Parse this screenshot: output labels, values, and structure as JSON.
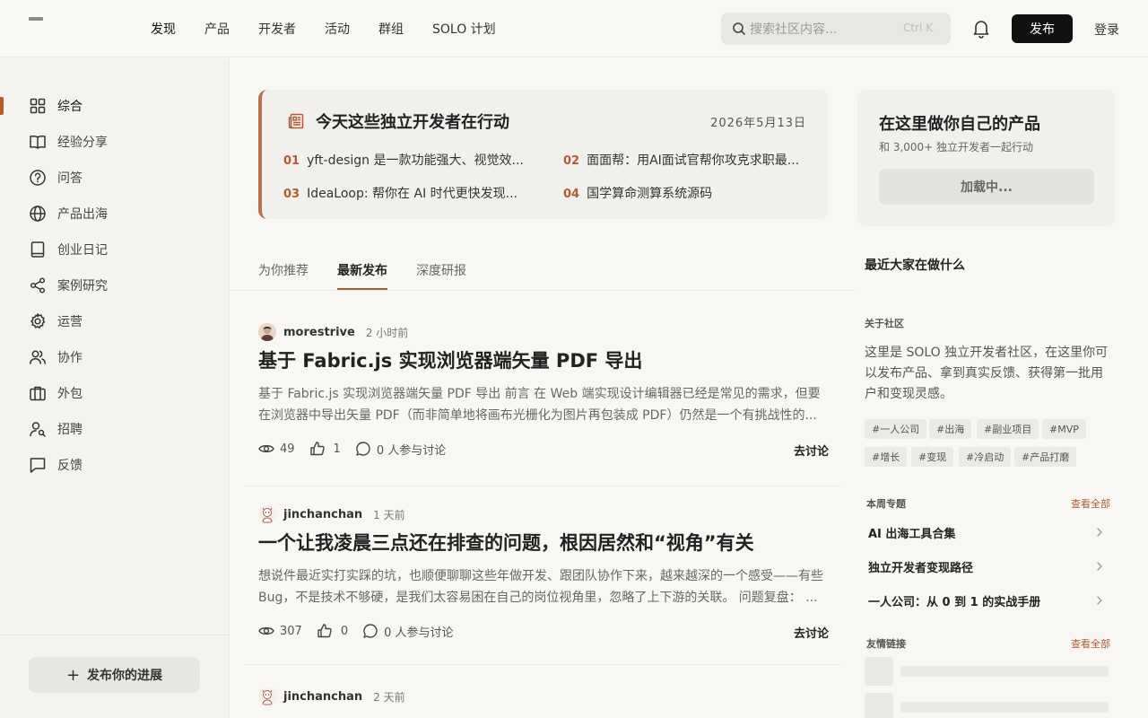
{
  "nav": {
    "items": [
      "发现",
      "产品",
      "开发者",
      "活动",
      "群组",
      "SOLO 计划"
    ],
    "search_placeholder": "搜索社区内容...",
    "search_shortcut": "Ctrl K",
    "publish_label": "发布",
    "login_label": "登录"
  },
  "sidebar": {
    "items": [
      {
        "label": "综合",
        "icon": "grid-icon"
      },
      {
        "label": "经验分享",
        "icon": "book-open-icon"
      },
      {
        "label": "问答",
        "icon": "question-circle-icon"
      },
      {
        "label": "产品出海",
        "icon": "globe-icon"
      },
      {
        "label": "创业日记",
        "icon": "notebook-icon"
      },
      {
        "label": "案例研究",
        "icon": "share-icon"
      },
      {
        "label": "运营",
        "icon": "gear-icon"
      },
      {
        "label": "协作",
        "icon": "users-icon"
      },
      {
        "label": "外包",
        "icon": "briefcase-icon"
      },
      {
        "label": "招聘",
        "icon": "user-search-icon"
      },
      {
        "label": "反馈",
        "icon": "message-square-icon"
      }
    ],
    "progress_button": "发布你的进展",
    "progress_plus": "+"
  },
  "today": {
    "title": "今天这些独立开发者在行动",
    "date": "2026年5月13日",
    "items": [
      {
        "num": "01",
        "text": "yft-design 是一款功能强大、视觉效..."
      },
      {
        "num": "02",
        "text": "面面帮：用AI面试官帮你攻克求职最..."
      },
      {
        "num": "03",
        "text": "IdeaLoop: 帮你在 AI 时代更快发现..."
      },
      {
        "num": "04",
        "text": "国学算命测算系统源码"
      }
    ]
  },
  "tabs": [
    "为你推荐",
    "最新发布",
    "深度研报"
  ],
  "posts": [
    {
      "author": "morestrive",
      "time": "2 小时前",
      "title": "基于 Fabric.js 实现浏览器端矢量 PDF 导出",
      "excerpt": "基于 Fabric.js 实现浏览器端矢量 PDF 导出 前言 在 Web 端实现设计编辑器已经是常见的需求，但要在浏览器中导出矢量 PDF（而非简单地将画布光栅化为图片再包装成 PDF）仍然是一个有挑战性的...",
      "views": "49",
      "likes": "1",
      "comments": "0 人参与讨论",
      "discuss": "去讨论"
    },
    {
      "author": "jinchanchan",
      "time": "1 天前",
      "title": "一个让我凌晨三点还在排查的问题，根因居然和“视角”有关",
      "excerpt": "想说件最近实打实踩的坑，也顺便聊聊这些年做开发、跟团队协作下来，越来越深的一个感受——有些 Bug，不是技术不够硬，是我们太容易困在自己的岗位视角里，忽略了上下游的关联。 问题复盘： ...",
      "views": "307",
      "likes": "0",
      "comments": "0 人参与讨论",
      "discuss": "去讨论"
    },
    {
      "author": "jinchanchan",
      "time": "2 天前"
    }
  ],
  "right": {
    "cta_title": "在这里做你自己的产品",
    "cta_sub": "和 3,000+ 独立开发者一起行动",
    "cta_button": "加载中...",
    "recent_heading": "最近大家在做什么",
    "about_heading": "关于社区",
    "about_text": "这里是 SOLO 独立开发者社区，在这里你可以发布产品、拿到真实反馈、获得第一批用户和变现灵感。",
    "tags": [
      "#一人公司",
      "#出海",
      "#副业项目",
      "#MVP",
      "#增长",
      "#变现",
      "#冷启动",
      "#产品打磨"
    ],
    "weekly_heading": "本周专题",
    "see_all": "查看全部",
    "topics": [
      "AI 出海工具合集",
      "独立开发者变现路径",
      "一人公司：从 0 到 1 的实战手册"
    ],
    "links_heading": "友情链接"
  },
  "colors": {
    "accent": "#b25b30",
    "primary": "#111111",
    "background": "#f8f7f3"
  }
}
